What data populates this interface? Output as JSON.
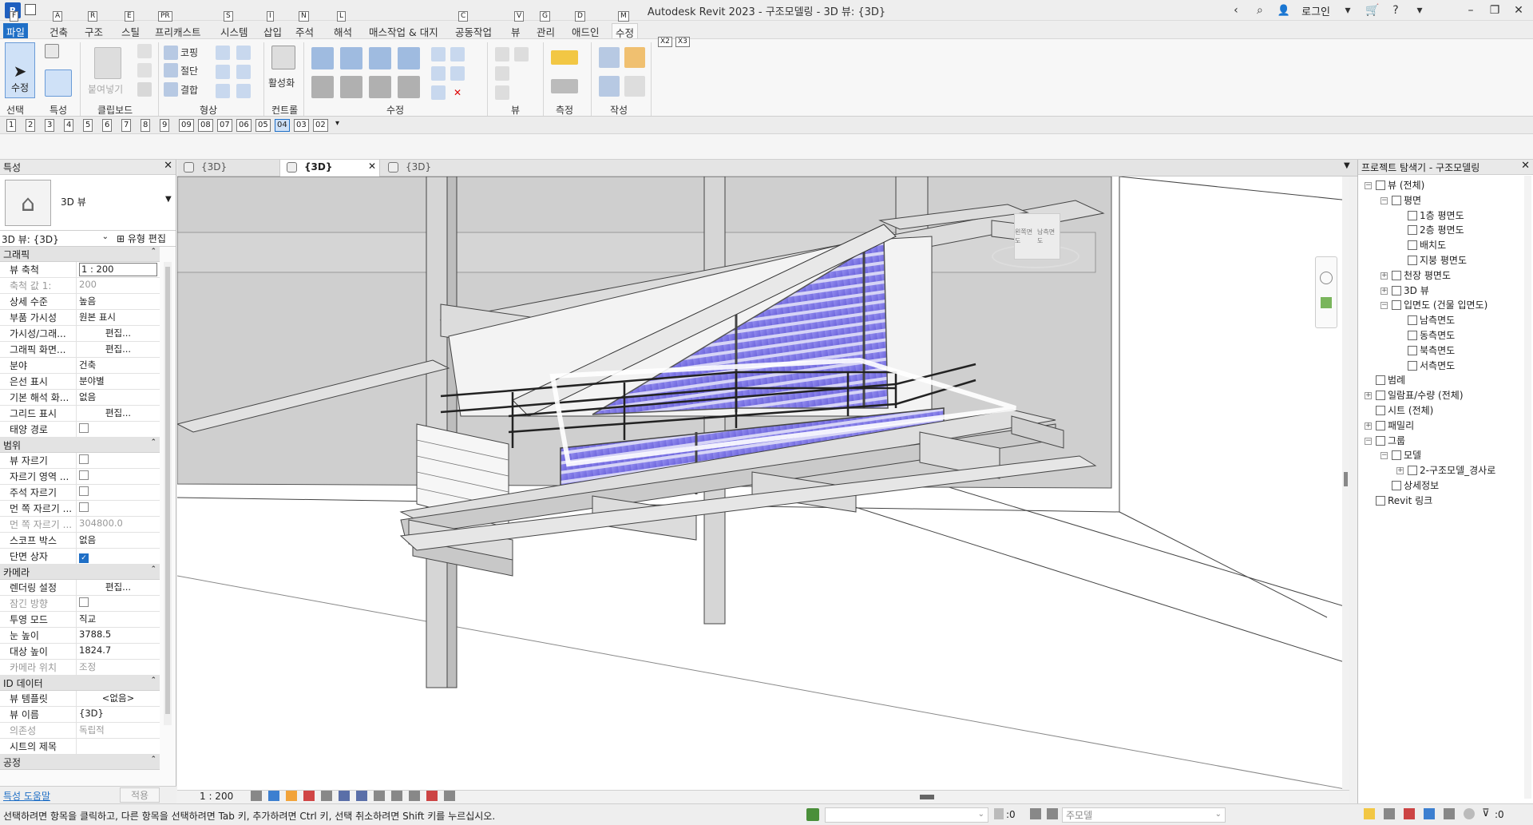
{
  "app": {
    "title": "Autodesk Revit 2023 - 구조모델링 - 3D 뷰: {3D}",
    "logo": "R",
    "login": "로그인"
  },
  "ribbon_tabs": [
    {
      "label": "파일",
      "key": "F"
    },
    {
      "label": "건축",
      "key": "A"
    },
    {
      "label": "구조",
      "key": "R"
    },
    {
      "label": "스틸",
      "key": "E"
    },
    {
      "label": "프리캐스트",
      "key": "PR"
    },
    {
      "label": "시스템",
      "key": "S"
    },
    {
      "label": "삽입",
      "key": "I"
    },
    {
      "label": "주석",
      "key": "N"
    },
    {
      "label": "해석",
      "key": "L"
    },
    {
      "label": "매스작업 & 대지",
      "key": ""
    },
    {
      "label": "공동작업",
      "key": "C"
    },
    {
      "label": "뷰",
      "key": "V"
    },
    {
      "label": "관리",
      "key": "G"
    },
    {
      "label": "애드인",
      "key": "D"
    },
    {
      "label": "수정",
      "key": "M"
    }
  ],
  "extra_keytips": [
    "X2",
    "X3"
  ],
  "ribbon": {
    "modify_label": "수정",
    "paste_label": "붙여넣기",
    "cope_label": "코핑",
    "cut_label": "절단",
    "join_label": "결합",
    "activate_label": "활성화",
    "panels": [
      "선택",
      "특성",
      "클립보드",
      "형상",
      "컨트롤",
      "수정",
      "뷰",
      "측정",
      "작성"
    ]
  },
  "qat_items": [
    "1",
    "2",
    "3",
    "4",
    "5",
    "6",
    "7",
    "8",
    "9",
    "09",
    "08",
    "07",
    "06",
    "05",
    "04",
    "03",
    "02"
  ],
  "properties": {
    "header": "특성",
    "type_name": "3D 뷰",
    "selector": "3D 뷰: {3D}",
    "edit_type": "유형 편집",
    "groups": [
      {
        "title": "그래픽",
        "rows": [
          {
            "name": "뷰 축척",
            "value": "1 : 200",
            "kind": "input"
          },
          {
            "name": "축척 값    1:",
            "value": "200",
            "kind": "disabled"
          },
          {
            "name": "상세 수준",
            "value": "높음",
            "kind": "text"
          },
          {
            "name": "부품 가시성",
            "value": "원본 표시",
            "kind": "text"
          },
          {
            "name": "가시성/그래...",
            "value": "편집...",
            "kind": "button"
          },
          {
            "name": "그래픽 화면...",
            "value": "편집...",
            "kind": "button"
          },
          {
            "name": "분야",
            "value": "건축",
            "kind": "text"
          },
          {
            "name": "은선 표시",
            "value": "분야별",
            "kind": "text"
          },
          {
            "name": "기본 해석 화...",
            "value": "없음",
            "kind": "text"
          },
          {
            "name": "그리드 표시",
            "value": "편집...",
            "kind": "button"
          },
          {
            "name": "태양 경로",
            "value": "",
            "kind": "check",
            "checked": false
          }
        ]
      },
      {
        "title": "범위",
        "rows": [
          {
            "name": "뷰 자르기",
            "value": "",
            "kind": "check",
            "checked": false
          },
          {
            "name": "자르기 영역 ...",
            "value": "",
            "kind": "check",
            "checked": false
          },
          {
            "name": "주석 자르기",
            "value": "",
            "kind": "check",
            "checked": false
          },
          {
            "name": "먼 쪽 자르기 ...",
            "value": "",
            "kind": "check",
            "checked": false
          },
          {
            "name": "먼 쪽 자르기 ...",
            "value": "304800.0",
            "kind": "disabled"
          },
          {
            "name": "스코프 박스",
            "value": "없음",
            "kind": "text"
          },
          {
            "name": "단면 상자",
            "value": "",
            "kind": "check",
            "checked": true
          }
        ]
      },
      {
        "title": "카메라",
        "rows": [
          {
            "name": "렌더링 설정",
            "value": "편집...",
            "kind": "button"
          },
          {
            "name": "잠긴 방향",
            "value": "",
            "kind": "check",
            "checked": false,
            "disabled": true
          },
          {
            "name": "투영 모드",
            "value": "직교",
            "kind": "text"
          },
          {
            "name": "눈 높이",
            "value": "3788.5",
            "kind": "text"
          },
          {
            "name": "대상 높이",
            "value": "1824.7",
            "kind": "text"
          },
          {
            "name": "카메라 위치",
            "value": "조정",
            "kind": "disabled"
          }
        ]
      },
      {
        "title": "ID 데이터",
        "rows": [
          {
            "name": "뷰 템플릿",
            "value": "<없음>",
            "kind": "button"
          },
          {
            "name": "뷰 이름",
            "value": "{3D}",
            "kind": "text"
          },
          {
            "name": "의존성",
            "value": "독립적",
            "kind": "disabled"
          },
          {
            "name": "시트의 제목",
            "value": "",
            "kind": "text"
          }
        ]
      },
      {
        "title": "공정",
        "rows": []
      }
    ],
    "help_link": "특성 도움말",
    "apply": "적용"
  },
  "view_tabs": [
    {
      "label": "{3D}",
      "active": false
    },
    {
      "label": "{3D}",
      "active": true
    },
    {
      "label": "{3D}",
      "active": false
    }
  ],
  "view_scale": "1 : 200",
  "viewcube": {
    "left": "왼쪽면도",
    "front": "남측면도"
  },
  "browser": {
    "header": "프로젝트 탐색기 - 구조모델링",
    "nodes": [
      {
        "label": "뷰 (전체)",
        "level": 0,
        "toggle": "-"
      },
      {
        "label": "평면",
        "level": 1,
        "toggle": "-"
      },
      {
        "label": "1층 평면도",
        "level": 2,
        "toggle": ""
      },
      {
        "label": "2층 평면도",
        "level": 2,
        "toggle": ""
      },
      {
        "label": "배치도",
        "level": 2,
        "toggle": ""
      },
      {
        "label": "지붕 평면도",
        "level": 2,
        "toggle": ""
      },
      {
        "label": "천장 평면도",
        "level": 1,
        "toggle": "+"
      },
      {
        "label": "3D 뷰",
        "level": 1,
        "toggle": "+"
      },
      {
        "label": "입면도 (건물 입면도)",
        "level": 1,
        "toggle": "-"
      },
      {
        "label": "남측면도",
        "level": 2,
        "toggle": ""
      },
      {
        "label": "동측면도",
        "level": 2,
        "toggle": ""
      },
      {
        "label": "북측면도",
        "level": 2,
        "toggle": ""
      },
      {
        "label": "서측면도",
        "level": 2,
        "toggle": ""
      },
      {
        "label": "범례",
        "level": 0,
        "toggle": ""
      },
      {
        "label": "일람표/수량 (전체)",
        "level": 0,
        "toggle": "+"
      },
      {
        "label": "시트 (전체)",
        "level": 0,
        "toggle": ""
      },
      {
        "label": "패밀리",
        "level": 0,
        "toggle": "+"
      },
      {
        "label": "그룹",
        "level": 0,
        "toggle": "-"
      },
      {
        "label": "모델",
        "level": 1,
        "toggle": "-"
      },
      {
        "label": "2-구조모델_경사로",
        "level": 2,
        "toggle": "+"
      },
      {
        "label": "상세정보",
        "level": 1,
        "toggle": ""
      },
      {
        "label": "Revit 링크",
        "level": 0,
        "toggle": ""
      }
    ]
  },
  "status": {
    "message": "선택하려면 항목을 클릭하고, 다른 항목을 선택하려면 Tab 키, 추가하려면 Ctrl 키, 선택 취소하려면 Shift 키를 누르십시오.",
    "zero1": ":0",
    "model": "주모델",
    "zero2": ":0"
  },
  "colors": {
    "accent": "#1f6fc6",
    "glass": "#7d76e6",
    "structure": "#dcdcdc"
  }
}
